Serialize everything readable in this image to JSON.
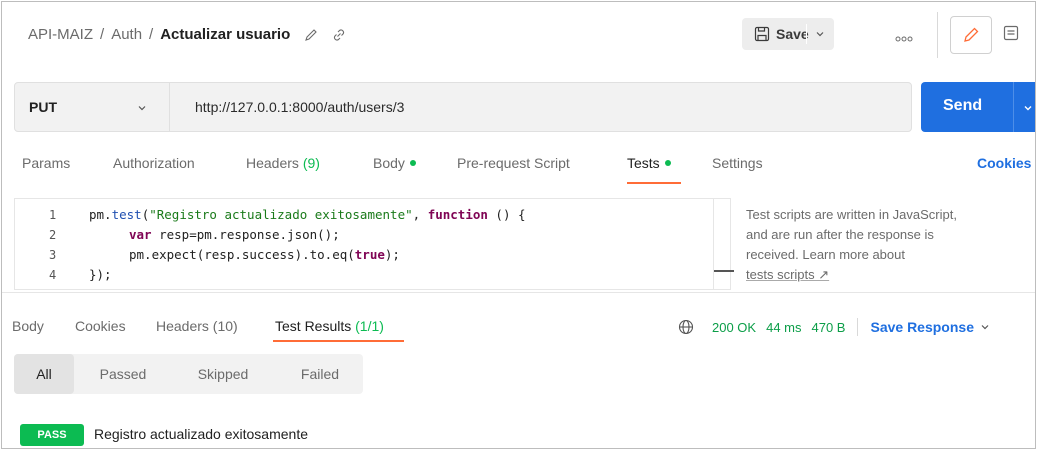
{
  "breadcrumb": {
    "collection": "API-MAIZ",
    "folder": "Auth",
    "request": "Actualizar usuario",
    "separator": "/"
  },
  "toolbar": {
    "save_label": "Save",
    "more_icon": "ellipsis-icon",
    "edit_icon": "pencil-icon",
    "docs_icon": "document-icon"
  },
  "request": {
    "method": "PUT",
    "url": "http://127.0.0.1:8000/auth/users/3",
    "send_label": "Send"
  },
  "request_tabs": {
    "params": "Params",
    "authorization": "Authorization",
    "headers": "Headers",
    "headers_count": "(9)",
    "body": "Body",
    "prerequest": "Pre-request Script",
    "tests": "Tests",
    "settings": "Settings",
    "cookies": "Cookies"
  },
  "editor": {
    "line_numbers": [
      "1",
      "2",
      "3",
      "4"
    ],
    "lines": {
      "l1_a": "pm.",
      "l1_b": "test",
      "l1_c": "(",
      "l1_str": "\"Registro actualizado exitosamente\"",
      "l1_d": ", ",
      "l1_kw": "function",
      "l1_e": " () {",
      "l2_kw": "var",
      "l2_rest": " resp=pm.response.json();",
      "l3_a": "pm.expect(resp.success).to.eq(",
      "l3_kw": "true",
      "l3_b": ");",
      "l4": "});"
    }
  },
  "help": {
    "line1": "Test scripts are written in JavaScript,",
    "line2": "and are run after the response is",
    "line3": "received. Learn more about",
    "link": "tests scripts ↗"
  },
  "response_tabs": {
    "body": "Body",
    "cookies": "Cookies",
    "headers": "Headers (10)",
    "test_results": "Test Results",
    "test_results_count": "(1/1)"
  },
  "response_status": {
    "status": "200 OK",
    "time": "44 ms",
    "size": "470 B",
    "save_response": "Save Response"
  },
  "filters": [
    "All",
    "Passed",
    "Skipped",
    "Failed"
  ],
  "results": [
    {
      "badge": "PASS",
      "name": "Registro actualizado exitosamente"
    }
  ],
  "colors": {
    "accent": "#1f6fe0",
    "tab_underline": "#ff6c37",
    "success": "#0cbb52"
  }
}
